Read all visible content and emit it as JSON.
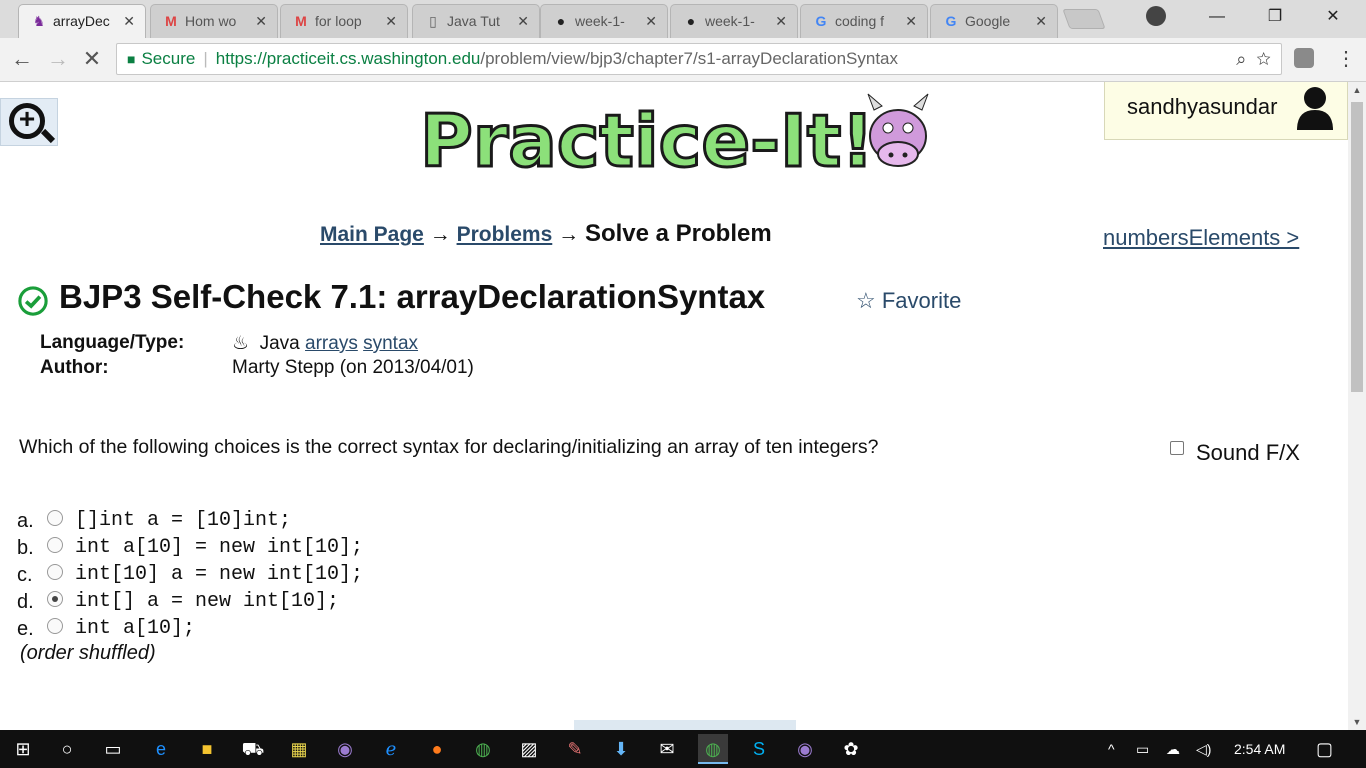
{
  "browser": {
    "tabs": [
      {
        "label": "arrayDec",
        "icon": "practiceit-icon",
        "active": true
      },
      {
        "label": "Hom wo",
        "icon": "gmail-icon",
        "active": false
      },
      {
        "label": "for loop",
        "icon": "gmail-icon",
        "active": false
      },
      {
        "label": "Java Tut",
        "icon": "page-icon",
        "active": false
      },
      {
        "label": "week-1-",
        "icon": "github-icon",
        "active": false
      },
      {
        "label": "week-1-",
        "icon": "github-icon",
        "active": false
      },
      {
        "label": "coding f",
        "icon": "google-icon",
        "active": false
      },
      {
        "label": "Google",
        "icon": "google-icon",
        "active": false
      }
    ],
    "tab_close": "✕",
    "secure_label": "Secure",
    "url_host": "https://practiceit.cs.washington.edu",
    "url_path": "/problem/view/bjp3/chapter7/s1-arrayDeclarationSyntax"
  },
  "header": {
    "user_name": "sandhyasundar"
  },
  "breadcrumb": {
    "main_page": "Main Page",
    "arrow1": "→",
    "problems": "Problems",
    "arrow2": "→",
    "current": "Solve a Problem"
  },
  "next_problem": "numbersElements >",
  "problem": {
    "title": "BJP3 Self-Check 7.1: arrayDeclarationSyntax",
    "favorite": "Favorite",
    "language_label": "Language/Type:",
    "language": "Java",
    "tag1": "arrays",
    "tag2": "syntax",
    "author_label": "Author:",
    "author": "Marty Stepp (on 2013/04/01)",
    "question": "Which of the following choices is the correct syntax for declaring/initializing an array of ten integers?",
    "sound_fx": "Sound F/X",
    "choices": [
      {
        "letter": "a.",
        "code": "[]int a = [10]int;",
        "selected": false
      },
      {
        "letter": "b.",
        "code": "int a[10] = new int[10];",
        "selected": false
      },
      {
        "letter": "c.",
        "code": "int[10] a = new int[10];",
        "selected": false
      },
      {
        "letter": "d.",
        "code": "int[] a = new int[10];",
        "selected": true
      },
      {
        "letter": "e.",
        "code": "int a[10];",
        "selected": false
      }
    ],
    "order_note": "(order shuffled)"
  },
  "taskbar": {
    "time": "2:54 AM"
  }
}
